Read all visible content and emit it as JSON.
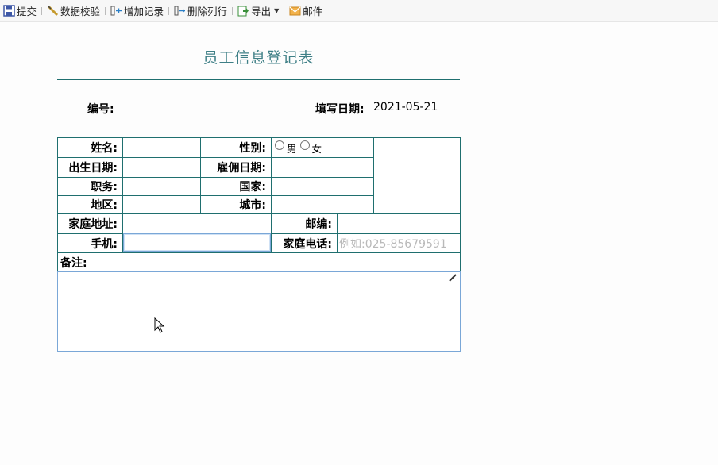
{
  "toolbar": {
    "submit": "提交",
    "validate": "数据校验",
    "add_record": "增加记录",
    "delete_row": "删除列行",
    "export": "导出",
    "mail": "邮件"
  },
  "form": {
    "title": "员工信息登记表",
    "number_label": "编号:",
    "fill_date_label": "填写日期:",
    "fill_date_value": "2021-05-21",
    "name_label": "姓名:",
    "gender_label": "性别:",
    "gender_options": [
      "男",
      "女"
    ],
    "birth_label": "出生日期:",
    "hire_label": "雇佣日期:",
    "title_label": "职务:",
    "country_label": "国家:",
    "region_label": "地区:",
    "city_label": "城市:",
    "address_label": "家庭地址:",
    "postcode_label": "邮编:",
    "mobile_label": "手机:",
    "home_phone_label": "家庭电话:",
    "home_phone_placeholder": "例如:025-85679591",
    "remarks_label": "备注:"
  },
  "colors": {
    "border": "#1f6f6f",
    "title": "#3e7f86",
    "focus": "#7aa7d7"
  }
}
